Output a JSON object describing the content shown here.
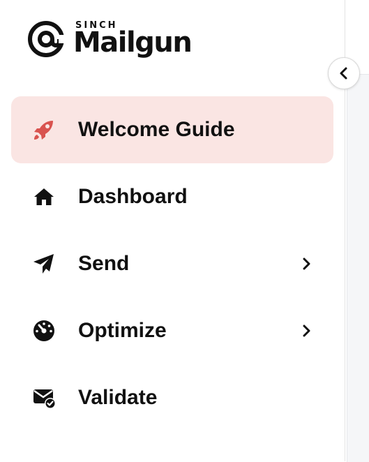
{
  "brand": {
    "company": "SINCH",
    "product": "Mailgun"
  },
  "collapse_button": {
    "icon": "chevron-left-icon"
  },
  "nav": {
    "items": [
      {
        "label": "Welcome Guide",
        "icon": "rocket-icon",
        "active": true,
        "has_submenu": false
      },
      {
        "label": "Dashboard",
        "icon": "home-icon",
        "active": false,
        "has_submenu": false
      },
      {
        "label": "Send",
        "icon": "paper-plane-icon",
        "active": false,
        "has_submenu": true
      },
      {
        "label": "Optimize",
        "icon": "speedometer-icon",
        "active": false,
        "has_submenu": true
      },
      {
        "label": "Validate",
        "icon": "envelope-check-icon",
        "active": false,
        "has_submenu": false
      }
    ]
  },
  "colors": {
    "active_background": "#fae5e3",
    "active_icon": "#d9534f",
    "text": "#111111"
  }
}
